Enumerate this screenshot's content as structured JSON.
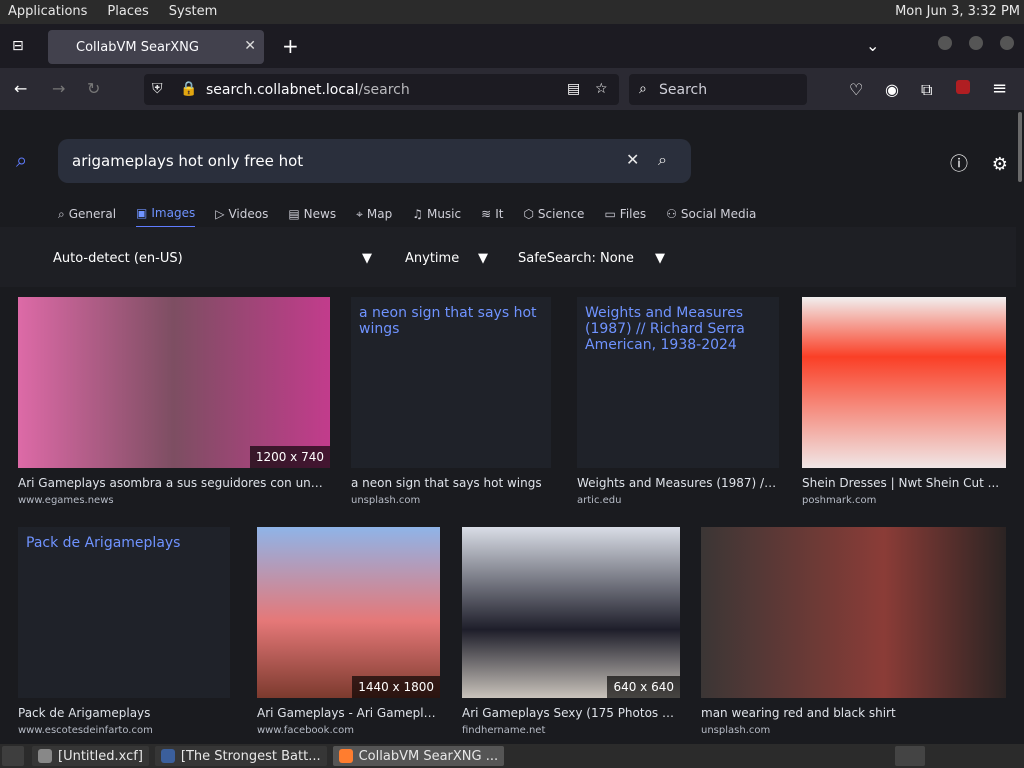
{
  "panel": {
    "menus": [
      "Applications",
      "Places",
      "System"
    ],
    "clock": "Mon Jun  3, 3:32 PM"
  },
  "browser": {
    "tab_title": "CollabVM SearXNG",
    "url_host": "search.collabnet.local",
    "url_path": "/search",
    "search_placeholder": "Search"
  },
  "search": {
    "query": "arigameplays hot only free hot",
    "categories": [
      {
        "label": "General",
        "icon": "search-icon"
      },
      {
        "label": "Images",
        "icon": "image-icon",
        "active": true
      },
      {
        "label": "Videos",
        "icon": "play-icon"
      },
      {
        "label": "News",
        "icon": "newspaper-icon"
      },
      {
        "label": "Map",
        "icon": "map-pin-icon"
      },
      {
        "label": "Music",
        "icon": "music-icon"
      },
      {
        "label": "It",
        "icon": "layers-icon"
      },
      {
        "label": "Science",
        "icon": "flask-icon"
      },
      {
        "label": "Files",
        "icon": "files-icon"
      },
      {
        "label": "Social Media",
        "icon": "people-icon"
      }
    ],
    "filters": {
      "language": "Auto-detect (en-US)",
      "time": "Anytime",
      "safesearch": "SafeSearch: None"
    }
  },
  "results": [
    {
      "caption": "Ari Gameplays asombra a sus seguidores con una f...",
      "source": "www.egames.news",
      "badge": "1200 x 740"
    },
    {
      "caption": "a neon sign that says hot wings",
      "source": "unsplash.com",
      "badge": "",
      "placeholder": "a neon sign that says hot wings"
    },
    {
      "caption": "Weights and Measures (1987) // ...",
      "source": "artic.edu",
      "badge": "",
      "placeholder": "Weights and Measures (1987) // Richard Serra American, 1938-2024"
    },
    {
      "caption": "Shein Dresses | Nwt Shein Cut ...",
      "source": "poshmark.com",
      "badge": ""
    },
    {
      "caption": "Pack de Arigameplays",
      "source": "www.escotesdeinfarto.com",
      "badge": "",
      "placeholder": "Pack de Arigameplays"
    },
    {
      "caption": "Ari Gameplays - Ari Gameplay...",
      "source": "www.facebook.com",
      "badge": "1440 x 1800"
    },
    {
      "caption": "Ari Gameplays Sexy (175 Photos + ...",
      "source": "findhername.net",
      "badge": "640 x 640"
    },
    {
      "caption": "man wearing red and black shirt",
      "source": "unsplash.com",
      "badge": ""
    }
  ],
  "taskbar": {
    "items": [
      "[Untitled.xcf]",
      "[The Strongest Batt...",
      "CollabVM SearXNG ..."
    ]
  }
}
